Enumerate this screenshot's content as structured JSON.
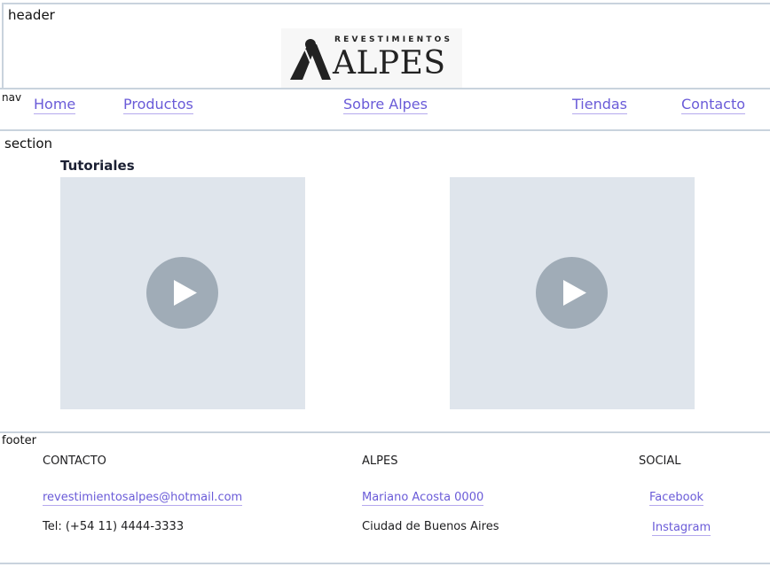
{
  "header": {
    "tag": "header",
    "logo": {
      "top_text": "REVESTIMIENTOS",
      "main_text": "ALPES"
    }
  },
  "nav": {
    "tag": "nav",
    "links": [
      "Home",
      "Productos",
      "Sobre Alpes",
      "Tiendas",
      "Contacto"
    ]
  },
  "section": {
    "tag": "section",
    "title": "Tutoriales",
    "videos": [
      {
        "icon": "play-icon"
      },
      {
        "icon": "play-icon"
      }
    ]
  },
  "footer": {
    "tag": "footer",
    "columns": [
      {
        "heading": "CONTACTO",
        "link": "revestimientosalpes@hotmail.com",
        "text": "Tel: (+54 11) 4444-3333"
      },
      {
        "heading": "ALPES",
        "link": "Mariano Acosta 0000",
        "text": "Ciudad de Buenos Aires"
      },
      {
        "heading": "SOCIAL",
        "link": "Facebook",
        "link2": "Instagram"
      }
    ]
  },
  "colors": {
    "link": "#6a5bd8",
    "border": "#c9d3dd",
    "video_bg": "#dfe5ec",
    "play": "#a0acb7"
  }
}
